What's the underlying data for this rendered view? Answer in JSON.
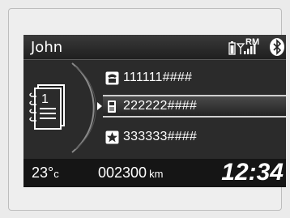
{
  "header": {
    "user_name": "John",
    "roaming_label": "RM",
    "icons": [
      "phone-battery-icon",
      "signal-strength-icon",
      "bluetooth-icon"
    ]
  },
  "contacts": [
    {
      "icon": "phone-icon",
      "number": "111111####",
      "selected": false
    },
    {
      "icon": "mobile-phone-icon",
      "number": "222222####",
      "selected": true
    },
    {
      "icon": "star-icon",
      "number": "333333####",
      "selected": false
    }
  ],
  "footer": {
    "temperature": "23°",
    "temperature_unit": "c",
    "odometer": "002300",
    "odometer_unit": "km",
    "clock": "12:34"
  },
  "colors": {
    "screen_bg": "#2b2b2b",
    "selection_border": "#cfcfcf",
    "text": "#ffffff"
  }
}
